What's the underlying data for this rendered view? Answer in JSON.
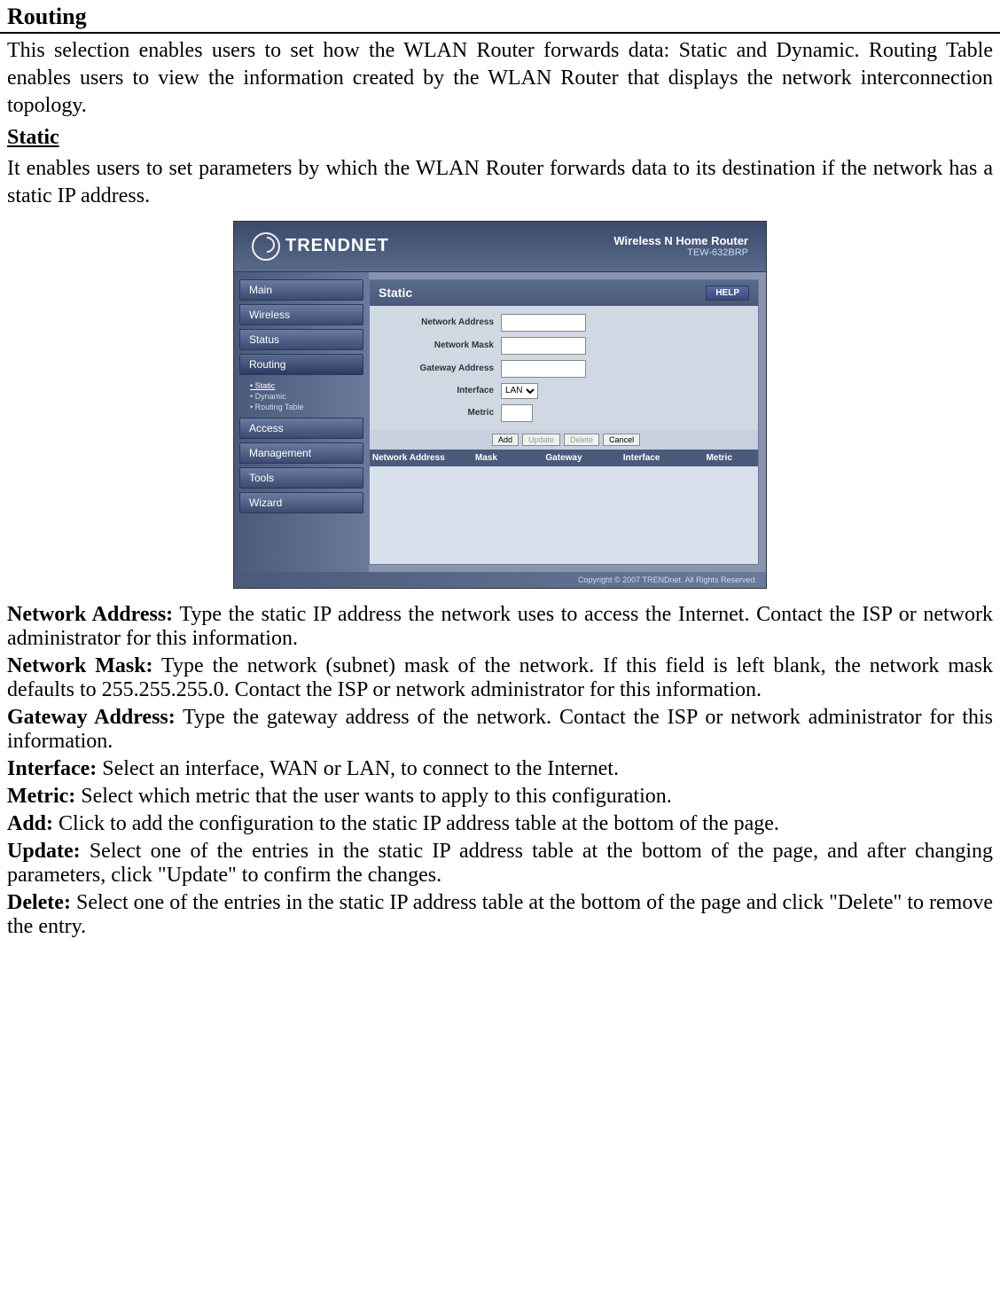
{
  "doc": {
    "title": "Routing",
    "intro": "This selection enables users to set how the WLAN Router forwards data: Static and Dynamic. Routing Table enables users to view the information created by the WLAN Router that displays the network interconnection topology.",
    "static_heading": "Static",
    "static_intro": "It enables users to set parameters by which the WLAN Router forwards data to its destination if the network has a static IP address.",
    "definitions": {
      "network_address": {
        "label": "Network Address:",
        "text": " Type the static IP address the network uses to access the Internet. Contact the ISP or network administrator for this information."
      },
      "network_mask": {
        "label": "Network Mask:",
        "text": " Type the network (subnet) mask of the network. If this field is left blank, the network mask defaults to 255.255.255.0.  Contact the ISP or network administrator for this information."
      },
      "gateway_address": {
        "label": "Gateway Address:",
        "text": " Type the gateway address of the network. Contact the ISP or network administrator for this information."
      },
      "interface": {
        "label": "Interface:",
        "text": " Select an interface, WAN or LAN, to connect to the Internet."
      },
      "metric": {
        "label": "Metric:",
        "text": " Select which metric that the user wants to apply to this configuration."
      },
      "add": {
        "label": "Add:",
        "text": " Click to add the configuration to the static IP address table at the bottom of the page."
      },
      "update": {
        "label": "Update:",
        "text": " Select one of the entries in the static IP address table at the bottom of the page, and after changing parameters, click \"Update\" to confirm the changes."
      },
      "delete": {
        "label": "Delete:",
        "text": " Select one of the entries in the static IP address table at the bottom of the page and click \"Delete\" to remove the entry."
      }
    }
  },
  "router": {
    "brand": "TRENDNET",
    "product": "Wireless N Home Router",
    "model": "TEW-632BRP",
    "copyright": "Copyright © 2007 TRENDnet. All Rights Reserved.",
    "nav": {
      "main": "Main",
      "wireless": "Wireless",
      "status": "Status",
      "routing": "Routing",
      "routing_sub": {
        "static": "Static",
        "dynamic": "Dynamic",
        "routing_table": "Routing Table"
      },
      "access": "Access",
      "management": "Management",
      "tools": "Tools",
      "wizard": "Wizard"
    },
    "panel": {
      "title": "Static",
      "help": "HELP",
      "labels": {
        "network_address": "Network Address",
        "network_mask": "Network Mask",
        "gateway_address": "Gateway Address",
        "interface": "Interface",
        "metric": "Metric"
      },
      "interface_value": "LAN",
      "buttons": {
        "add": "Add",
        "update": "Update",
        "delete": "Delete",
        "cancel": "Cancel"
      },
      "table_headers": {
        "network_address": "Network Address",
        "mask": "Mask",
        "gateway": "Gateway",
        "interface": "Interface",
        "metric": "Metric"
      }
    }
  }
}
